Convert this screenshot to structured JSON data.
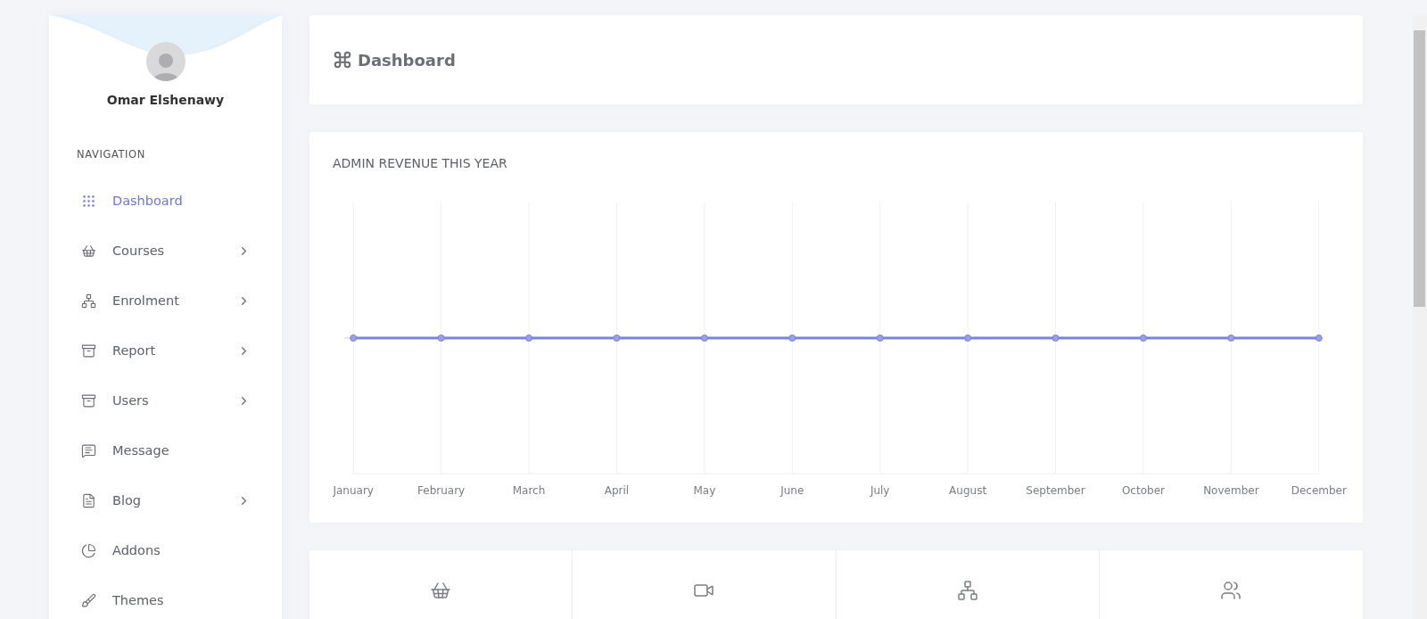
{
  "sidebar": {
    "user": {
      "name": "Omar Elshenawy"
    },
    "section_title": "NAVIGATION",
    "items": [
      {
        "label": "Dashboard",
        "selected": true,
        "has_submenu": false
      },
      {
        "label": "Courses",
        "selected": false,
        "has_submenu": true
      },
      {
        "label": "Enrolment",
        "selected": false,
        "has_submenu": true
      },
      {
        "label": "Report",
        "selected": false,
        "has_submenu": true
      },
      {
        "label": "Users",
        "selected": false,
        "has_submenu": true
      },
      {
        "label": "Message",
        "selected": false,
        "has_submenu": false
      },
      {
        "label": "Blog",
        "selected": false,
        "has_submenu": true
      },
      {
        "label": "Addons",
        "selected": false,
        "has_submenu": false
      },
      {
        "label": "Themes",
        "selected": false,
        "has_submenu": false
      }
    ]
  },
  "header": {
    "title": "Dashboard"
  },
  "revenue_chart": {
    "title": "ADMIN REVENUE THIS YEAR",
    "x_labels": [
      "January",
      "February",
      "March",
      "April",
      "May",
      "June",
      "July",
      "August",
      "September",
      "October",
      "November",
      "December"
    ]
  },
  "stats": [
    {
      "kind": "courses"
    },
    {
      "kind": "videos"
    },
    {
      "kind": "enrolments"
    },
    {
      "kind": "users"
    }
  ]
}
